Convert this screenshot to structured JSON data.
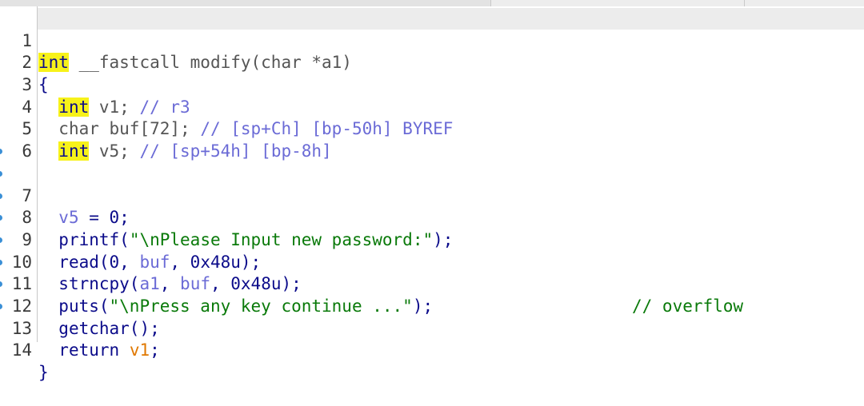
{
  "lines": [
    {
      "n": "1"
    },
    {
      "n": "2"
    },
    {
      "n": "3"
    },
    {
      "n": "4"
    },
    {
      "n": "5"
    },
    {
      "n": "6"
    },
    {
      "n": "7"
    },
    {
      "n": "8"
    },
    {
      "n": "9"
    },
    {
      "n": "10"
    },
    {
      "n": "11"
    },
    {
      "n": "12"
    },
    {
      "n": "13"
    },
    {
      "n": "14"
    }
  ],
  "code": {
    "l1_kw": "int",
    "l1_rest": " __fastcall modify(char *a1)",
    "l2": "{",
    "l3_kw": "int",
    "l3_var": " v1; ",
    "l3_cm": "// r3",
    "l4_type": "char buf[72]; ",
    "l4_cm": "// [sp+Ch] [bp-50h] BYREF",
    "l5_kw": "int",
    "l5_var": " v5; ",
    "l5_cm": "// [sp+54h] [bp-8h]",
    "l7_var": "v5",
    "l7_rest": " = 0;",
    "l8_fn": "printf(",
    "l8_str": "\"\\nPlease Input new password:\"",
    "l8_end": ");",
    "l9_fn": "read(0, ",
    "l9_var": "buf",
    "l9_end": ", 0x48u);",
    "l10_fn": "strncpy(",
    "l10_var1": "a1",
    "l10_mid": ", ",
    "l10_var2": "buf",
    "l10_end": ", 0x48u);",
    "l10_cm": "// overflow",
    "l11_fn": "puts(",
    "l11_str": "\"\\nPress any key continue ...\"",
    "l11_end": ");",
    "l12": "getchar();",
    "l13_kw": "return ",
    "l13_var": "v1",
    "l13_end": ";",
    "l14": "}"
  }
}
